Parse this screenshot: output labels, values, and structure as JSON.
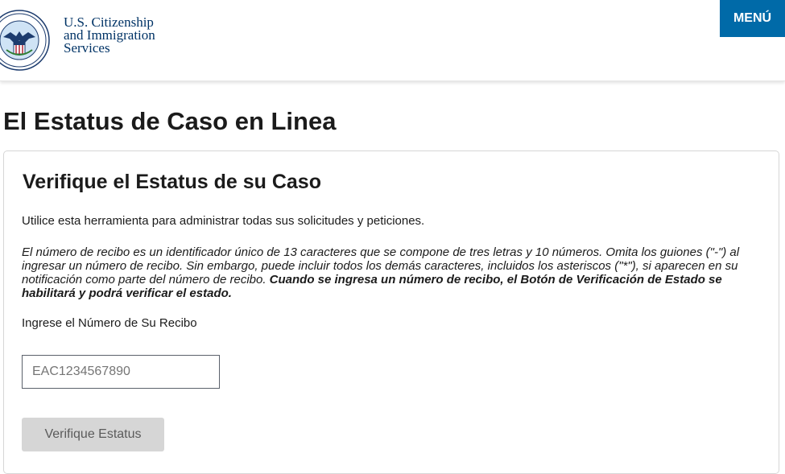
{
  "header": {
    "agency_line1": "U.S. Citizenship",
    "agency_line2": "and Immigration",
    "agency_line3": "Services",
    "menu_label": "MENÚ"
  },
  "page": {
    "title": "El Estatus de Caso en Linea"
  },
  "card": {
    "title": "Verifique el Estatus de su Caso",
    "intro": "Utilice esta herramienta para administrar todas sus solicitudes y peticiones.",
    "note_italic": "El número de recibo es un identificador único de 13 caracteres que se compone de tres letras y 10 números. Omita los guiones (\"-\") al ingresar un número de recibo. Sin embargo, puede incluir todos los demás caracteres, incluidos los asteriscos (\"*\"), si aparecen en su notificación como parte del número de recibo. ",
    "note_bold": "Cuando se ingresa un número de recibo, el Botón de Verificación de Estado se habilitará y podrá verificar el estado.",
    "field_label": "Ingrese el Número de Su Recibo",
    "input_value": "",
    "input_placeholder": "EAC1234567890",
    "submit_label": "Verifique Estatus"
  },
  "colors": {
    "menu_bg": "#006aa8",
    "agency_text": "#003366",
    "button_disabled_bg": "#d6d6d6"
  }
}
